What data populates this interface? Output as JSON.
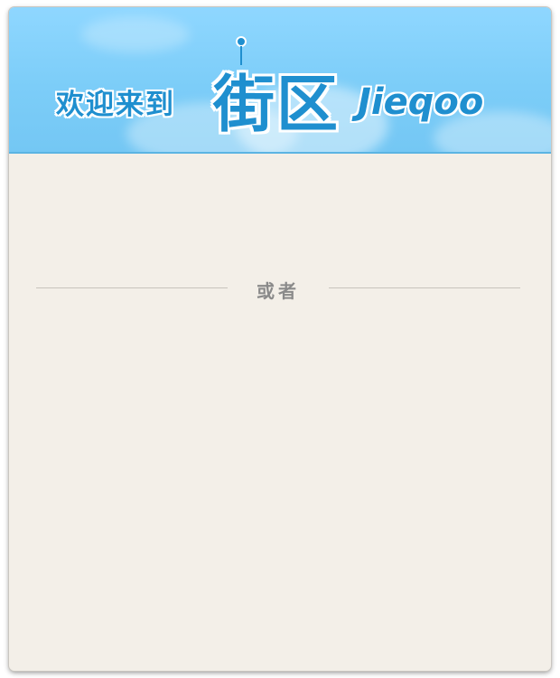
{
  "banner": {
    "welcome_text": "欢迎来到",
    "logo_cn": "街区",
    "logo_en": "Jieqoo"
  },
  "body": {
    "separator_text": "或者"
  },
  "colors": {
    "banner_sky": "#8fd7ff",
    "brand_blue": "#1f8fcf",
    "panel_background": "#f3efe8",
    "separator_line": "#c8c4bc",
    "separator_text": "#8a8a8a"
  },
  "icons": {
    "logo_pin": "map-pin-icon"
  }
}
